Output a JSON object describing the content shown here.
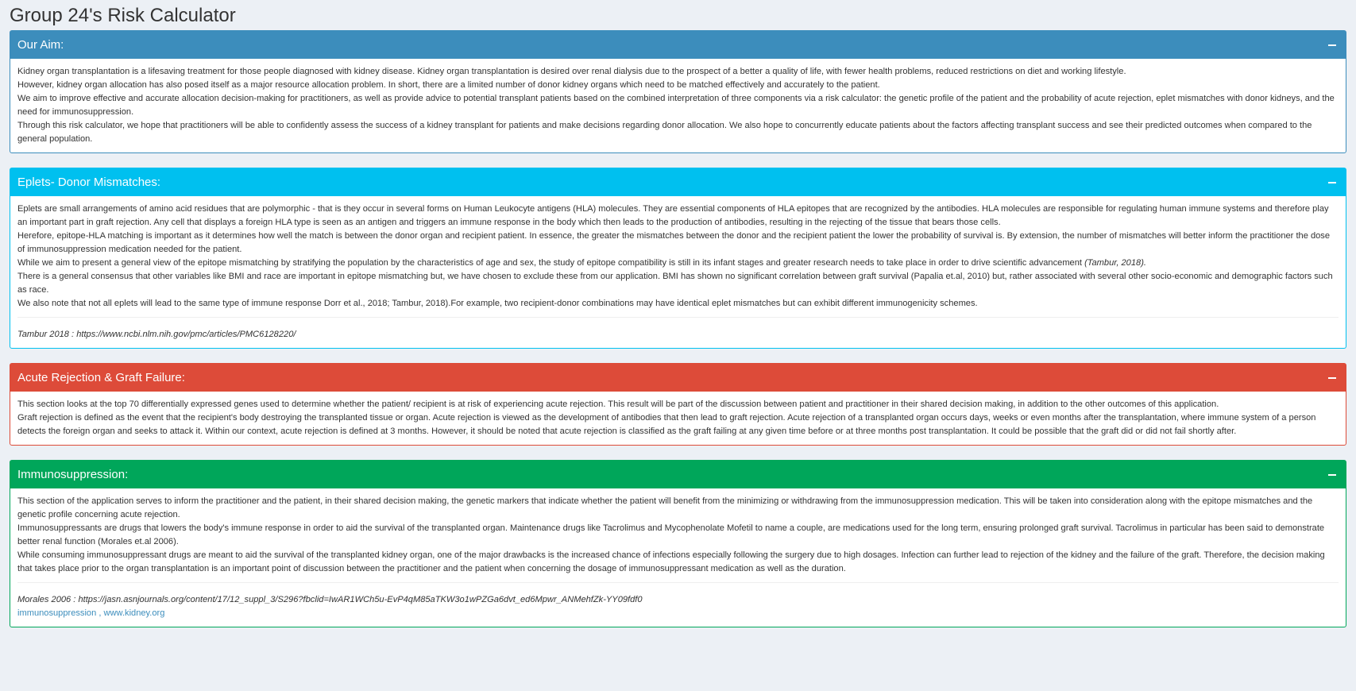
{
  "page": {
    "title": "Group 24's Risk Calculator"
  },
  "colors": {
    "aim": "#3c8dbc",
    "eplets": "#00c0ef",
    "acute": "#dd4b39",
    "immuno": "#00a65a",
    "background": "#ecf0f5",
    "link": "#3c8dbc"
  },
  "icons": {
    "collapse": "minus-icon"
  },
  "aim": {
    "title": "Our Aim:",
    "paragraphs": [
      "Kidney organ transplantation is a lifesaving treatment for those people diagnosed with kidney disease. Kidney organ transplantation is desired over renal dialysis due to the prospect of a better a quality of life, with fewer health problems, reduced restrictions on diet and working lifestyle.",
      "However, kidney organ allocation has also posed itself as a major resource allocation problem. In short, there are a limited number of donor kidney organs which need to be matched effectively and accurately to the patient.",
      "We aim to improve effective and accurate allocation decision-making for practitioners, as well as provide advice to potential transplant patients based on the combined interpretation of three components via a risk calculator: the genetic profile of the patient and the probability of acute rejection, eplet mismatches with donor kidneys, and the need for immunosuppression.",
      "Through this risk calculator, we hope that practitioners will be able to confidently assess the success of a kidney transplant for patients and make decisions regarding donor allocation. We also hope to concurrently educate patients about the factors affecting transplant success and see their predicted outcomes when compared to the general population."
    ]
  },
  "eplets": {
    "title": "Eplets- Donor Mismatches:",
    "paragraphs": [
      "Eplets are small arrangements of amino acid residues that are polymorphic - that is they occur in several forms on Human Leukocyte antigens (HLA) molecules. They are essential components of HLA epitopes that are recognized by the antibodies. HLA molecules are responsible for regulating human immune systems and therefore play an important part in graft rejection. Any cell that displays a foreign HLA type is seen as an antigen and triggers an immune response in the body which then leads to the production of antibodies, resulting in the rejecting of the tissue that bears those cells.",
      "Herefore, epitope-HLA matching is important as it determines how well the match is between the donor organ and recipient patient. In essence, the greater the mismatches between the donor and the recipient patient the lower the probability of survival is. By extension, the number of mismatches will better inform the practitioner the dose of immunosuppression medication needed for the patient."
    ],
    "p3_main": "While we aim to present a general view of the epitope mismatching by stratifying the population by the characteristics of age and sex, the study of epitope compatibility is still in its infant stages and greater research needs to take place in order to drive scientific advancement ",
    "p3_cite": "(Tambur, 2018).",
    "paragraphs_after": [
      "There is a general consensus that other variables like BMI and race are important in epitope mismatching but, we have chosen to exclude these from our application. BMI has shown no significant correlation between graft survival (Papalia et.al, 2010) but, rather associated with several other socio-economic and demographic factors such as race.",
      "We also note that not all eplets will lead to the same type of immune response Dorr et al., 2018; Tambur, 2018).For example, two recipient-donor combinations may have identical eplet mismatches but can exhibit different immunogenicity schemes."
    ],
    "reference": "Tambur 2018 : https://www.ncbi.nlm.nih.gov/pmc/articles/PMC6128220/"
  },
  "acute": {
    "title": "Acute Rejection & Graft Failure:",
    "paragraphs": [
      "This section looks at the top 70 differentially expressed genes used to determine whether the patient/ recipient is at risk of experiencing acute rejection. This result will be part of the discussion between patient and practitioner in their shared decision making, in addition to the other outcomes of this application.",
      "Graft rejection is defined as the event that the recipient's body destroying the transplanted tissue or organ. Acute rejection is viewed as the development of antibodies that then lead to graft rejection. Acute rejection of a transplanted organ occurs days, weeks or even months after the transplantation, where immune system of a person detects the foreign organ and seeks to attack it. Within our context, acute rejection is defined at 3 months. However, it should be noted that acute rejection is classified as the graft failing at any given time before or at three months post transplantation. It could be possible that the graft did or did not fail shortly after."
    ]
  },
  "immuno": {
    "title": "Immunosuppression:",
    "paragraphs": [
      "This section of the application serves to inform the practitioner and the patient, in their shared decision making, the genetic markers that indicate whether the patient will benefit from the minimizing or withdrawing from the immunosuppression medication. This will be taken into consideration along with the epitope mismatches and the genetic profile concerning acute rejection.",
      "Immunosuppressants are drugs that lowers the body's immune response in order to aid the survival of the transplanted organ. Maintenance drugs like Tacrolimus and Mycophenolate Mofetil to name a couple, are medications used for the long term, ensuring prolonged graft survival. Tacrolimus in particular has been said to demonstrate better renal function (Morales et.al 2006).",
      "While consuming immunosuppressant drugs are meant to aid the survival of the transplanted kidney organ, one of the major drawbacks is the increased chance of infections especially following the surgery due to high dosages. Infection can further lead to rejection of the kidney and the failure of the graft. Therefore, the decision making that takes place prior to the organ transplantation is an important point of discussion between the practitioner and the patient when concerning the dosage of immunosuppressant medication as well as the duration."
    ],
    "reference": "Morales 2006 : https://jasn.asnjournals.org/content/17/12_suppl_3/S296?fbclid=IwAR1WCh5u-EvP4qM85aTKW3o1wPZGa6dvt_ed6Mpwr_ANMehfZk-YY09fdf0",
    "link1": "immunosuppression",
    "link_sep": " , ",
    "link2": "www.kidney.org"
  }
}
